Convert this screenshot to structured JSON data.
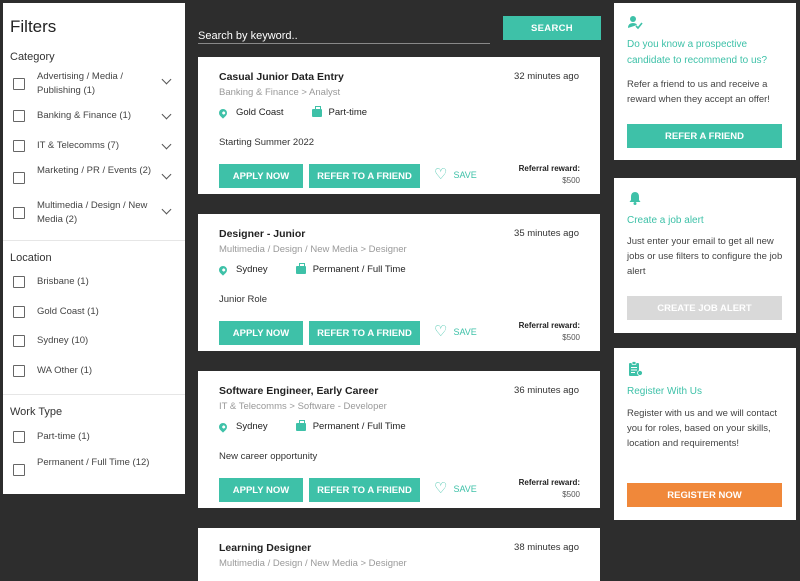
{
  "filters": {
    "title": "Filters",
    "category": {
      "title": "Category",
      "items": [
        {
          "label": "Advertising / Media / Publishing (1)"
        },
        {
          "label": "Banking & Finance (1)"
        },
        {
          "label": "IT & Telecomms (7)"
        },
        {
          "label": "Marketing / PR / Events (2)"
        },
        {
          "label": "Multimedia / Design / New Media (2)"
        }
      ]
    },
    "location": {
      "title": "Location",
      "items": [
        {
          "label": "Brisbane (1)"
        },
        {
          "label": "Gold Coast (1)"
        },
        {
          "label": "Sydney (10)"
        },
        {
          "label": "WA Other (1)"
        }
      ]
    },
    "work_type": {
      "title": "Work Type",
      "items": [
        {
          "label": "Part-time (1)"
        },
        {
          "label": "Permanent / Full Time (12)"
        }
      ]
    }
  },
  "search": {
    "placeholder": "Search by keyword..",
    "button_label": "SEARCH"
  },
  "jobs": [
    {
      "title": "Casual Junior Data Entry",
      "time": "32 minutes ago",
      "category": "Banking & Finance > Analyst",
      "location": "Gold Coast",
      "work_type": "Part-time",
      "description": "Starting Summer 2022",
      "apply_label": "APPLY NOW",
      "refer_label": "REFER TO A FRIEND",
      "save_label": "SAVE",
      "reward_label": "Referral reward:",
      "reward_value": "$500"
    },
    {
      "title": "Designer - Junior",
      "time": "35 minutes ago",
      "category": "Multimedia / Design / New Media > Designer",
      "location": "Sydney",
      "work_type": "Permanent / Full Time",
      "description": "Junior Role",
      "apply_label": "APPLY NOW",
      "refer_label": "REFER TO A FRIEND",
      "save_label": "SAVE",
      "reward_label": "Referral reward:",
      "reward_value": "$500"
    },
    {
      "title": "Software Engineer, Early Career",
      "time": "36 minutes ago",
      "category": "IT & Telecomms > Software - Developer",
      "location": "Sydney",
      "work_type": "Permanent / Full Time",
      "description": "New career opportunity",
      "apply_label": "APPLY NOW",
      "refer_label": "REFER TO A FRIEND",
      "save_label": "SAVE",
      "reward_label": "Referral reward:",
      "reward_value": "$500"
    },
    {
      "title": "Learning Designer",
      "time": "38 minutes ago",
      "category": "Multimedia / Design / New Media > Designer"
    }
  ],
  "panels": {
    "refer": {
      "icon": "refer-user-icon",
      "title": "Do you know a prospective candidate to recommend to us?",
      "text": "Refer a friend to us and receive a reward when they accept an offer!",
      "button_label": "REFER A FRIEND"
    },
    "alert": {
      "icon": "bell-icon",
      "title": "Create a job alert",
      "text": "Just enter your email to get all new jobs or use filters to configure the job alert",
      "button_label": "CREATE JOB ALERT"
    },
    "register": {
      "icon": "clipboard-icon",
      "title": "Register With Us",
      "text": "Register with us and we will contact you for roles, based on your skills, location and requirements!",
      "button_label": "REGISTER NOW"
    }
  },
  "colors": {
    "accent": "#3ec1a8",
    "register": "#f0883a",
    "disabled": "#d9d9d9",
    "background": "#2d2d2d"
  }
}
